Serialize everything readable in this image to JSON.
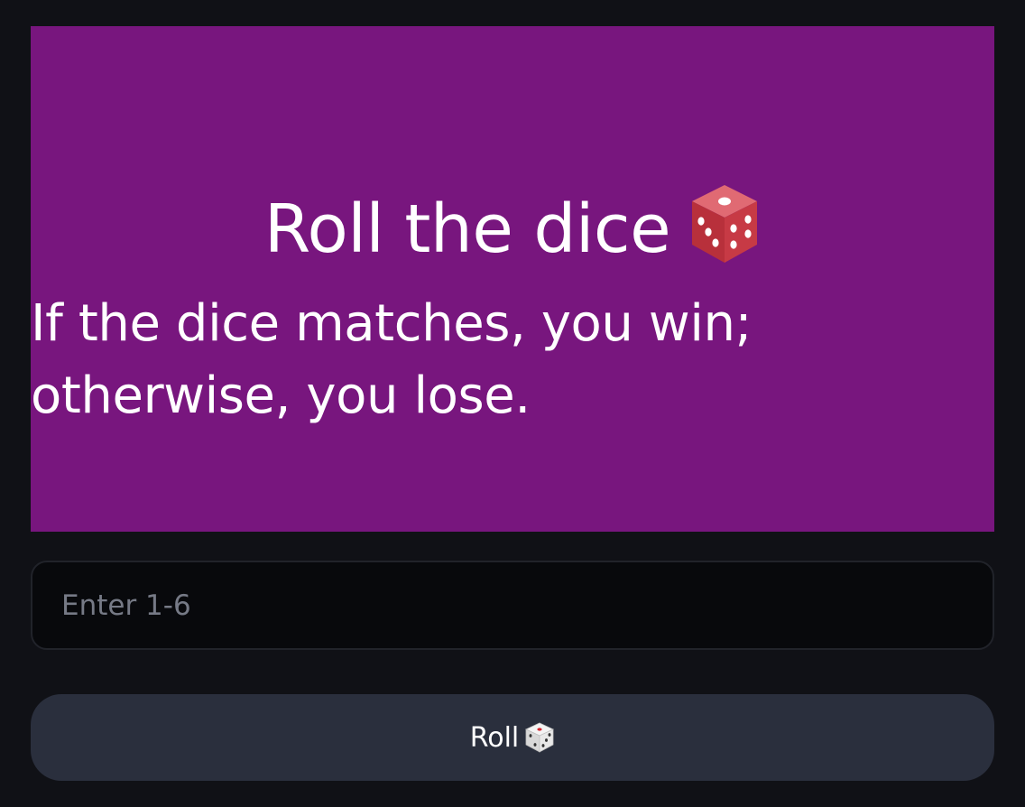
{
  "banner": {
    "title": "Roll the dice",
    "title_icon": "red-die-icon",
    "subtitle": "If the dice matches, you win; otherwise, you lose.",
    "background": "#78167e"
  },
  "guess_input": {
    "placeholder": "Enter 1-6",
    "value": ""
  },
  "roll_button": {
    "label": "Roll",
    "icon": "white-die-icon",
    "background": "#2a2f3d"
  }
}
